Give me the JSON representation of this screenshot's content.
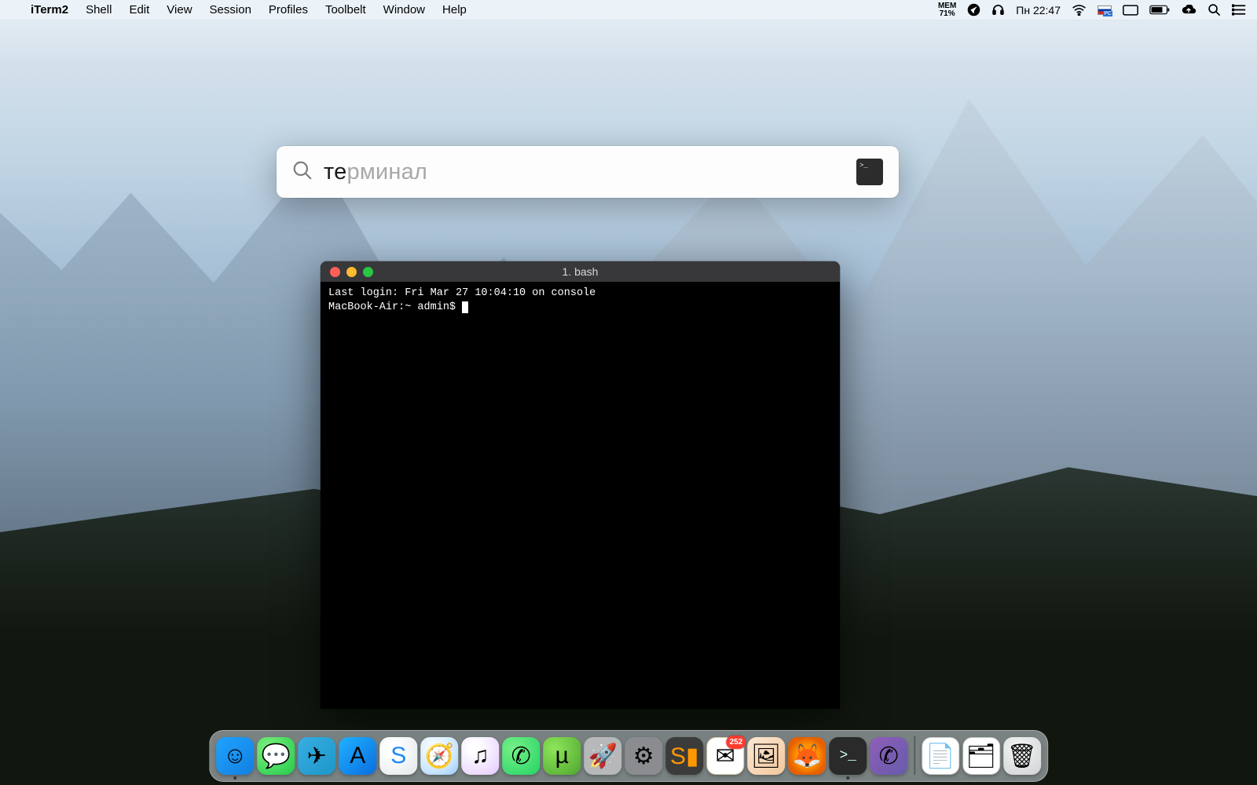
{
  "menubar": {
    "app_name": "iTerm2",
    "items": [
      "Shell",
      "Edit",
      "View",
      "Session",
      "Profiles",
      "Toolbelt",
      "Window",
      "Help"
    ],
    "status": {
      "mem_label": "MEM",
      "mem_pct": "71%",
      "clock": "Пн 22:47"
    }
  },
  "spotlight": {
    "typed": "те",
    "completion": "рминал",
    "result_icon_glyph": ">_"
  },
  "terminal": {
    "title": "1. bash",
    "line1": "Last login: Fri Mar 27 10:04:10 on console",
    "line2": "MacBook-Air:~ admin$ "
  },
  "dock": {
    "items": [
      {
        "name": "finder",
        "cls": "di-finder",
        "glyph": "☺",
        "running": true
      },
      {
        "name": "messages",
        "cls": "di-messages",
        "glyph": "💬"
      },
      {
        "name": "telegram",
        "cls": "di-telegram",
        "glyph": "✈"
      },
      {
        "name": "appstore",
        "cls": "di-appstore",
        "glyph": "A"
      },
      {
        "name": "sogou",
        "cls": "di-sogou",
        "glyph": "S"
      },
      {
        "name": "safari",
        "cls": "di-safari",
        "glyph": "🧭"
      },
      {
        "name": "itunes",
        "cls": "di-itunes",
        "glyph": "♫"
      },
      {
        "name": "whatsapp",
        "cls": "di-whatsapp",
        "glyph": "✆"
      },
      {
        "name": "utorrent",
        "cls": "di-utorrent",
        "glyph": "µ"
      },
      {
        "name": "launchpad",
        "cls": "di-launchpad",
        "glyph": "🚀"
      },
      {
        "name": "settings",
        "cls": "di-settings",
        "glyph": "⚙"
      },
      {
        "name": "sublime",
        "cls": "di-sublime",
        "glyph": "S▮"
      },
      {
        "name": "mail",
        "cls": "di-mail",
        "glyph": "✉",
        "badge": "252"
      },
      {
        "name": "photos",
        "cls": "di-photos",
        "glyph": "🖼"
      },
      {
        "name": "firefox",
        "cls": "di-firefox",
        "glyph": "🦊"
      },
      {
        "name": "iterm",
        "cls": "di-iterm",
        "glyph": ">_",
        "running": true
      },
      {
        "name": "viber",
        "cls": "di-viber",
        "glyph": "✆"
      }
    ],
    "right_items": [
      {
        "name": "document",
        "cls": "di-doc",
        "glyph": "📄"
      },
      {
        "name": "desktop-stack",
        "cls": "di-folder",
        "glyph": "🗂"
      },
      {
        "name": "trash",
        "cls": "di-trash",
        "glyph": "🗑"
      }
    ]
  }
}
